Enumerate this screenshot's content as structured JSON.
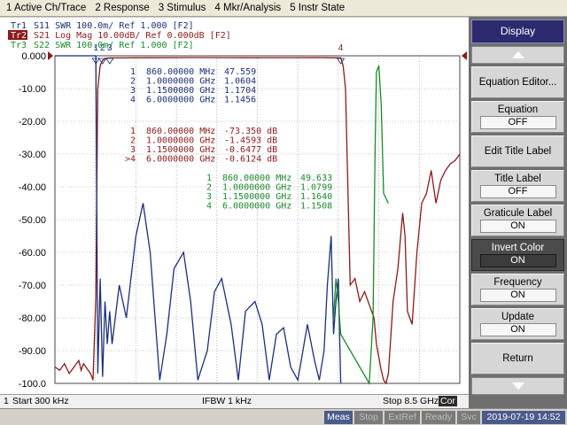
{
  "menu": [
    "1 Active Ch/Trace",
    "2 Response",
    "3 Stimulus",
    "4 Mkr/Analysis",
    "5 Instr State"
  ],
  "traces": [
    {
      "label": "Tr1",
      "text": "S11  SWR 100.0m/ Ref 1.000 [F2]",
      "color": "#1c2f78"
    },
    {
      "label": "Tr2",
      "text": "S21  Log Mag 10.00dB/ Ref 0.000dB [F2]",
      "color": "#8b1a1a"
    },
    {
      "label": "Tr3",
      "text": "S22  SWR 100.0m/ Ref 1.000 [F2]",
      "color": "#1a8a2a"
    }
  ],
  "y_tick_labels": [
    "0.000",
    "-10.00",
    "-20.00",
    "-30.00",
    "-40.00",
    "-50.00",
    "-60.00",
    "-70.00",
    "-80.00",
    "-90.00",
    "-100.0"
  ],
  "marker_tables": [
    {
      "color": "#1c2f78",
      "rows": [
        {
          "id": "1",
          "freq": "860.00000 MHz",
          "value": "47.559"
        },
        {
          "id": "2",
          "freq": "1.0000000 GHz",
          "value": "1.0604"
        },
        {
          "id": "3",
          "freq": "1.1500000 GHz",
          "value": "1.1704"
        },
        {
          "id": "4",
          "freq": "6.0000000 GHz",
          "value": "1.1456"
        }
      ]
    },
    {
      "color": "#8b1a1a",
      "rows": [
        {
          "id": "1",
          "freq": "860.00000 MHz",
          "value": "-73.350 dB"
        },
        {
          "id": "2",
          "freq": "1.0000000 GHz",
          "value": "-1.4593 dB"
        },
        {
          "id": "3",
          "freq": "1.1500000 GHz",
          "value": "-0.6477 dB"
        },
        {
          "id": ">4",
          "freq": "6.0000000 GHz",
          "value": "-0.6124 dB"
        }
      ]
    },
    {
      "color": "#1a8a2a",
      "rows": [
        {
          "id": "1",
          "freq": "860.00000 MHz",
          "value": "49.633"
        },
        {
          "id": "2",
          "freq": "1.0000000 GHz",
          "value": "1.0799"
        },
        {
          "id": "3",
          "freq": "1.1500000 GHz",
          "value": "1.1640"
        },
        {
          "id": "4",
          "freq": "6.0000000 GHz",
          "value": "1.1508"
        }
      ]
    }
  ],
  "marker_flags": [
    "1",
    "2",
    "3",
    "4"
  ],
  "status": {
    "channel": "1",
    "start": "Start 300 kHz",
    "ifbw": "IFBW 1 kHz",
    "stop": "Stop 8.5 GHz",
    "cor": "Cor"
  },
  "bottom": {
    "meas": "Meas",
    "stop": "Stop",
    "extref": "ExtRef",
    "ready": "Ready",
    "svc": "Svc",
    "datetime": "2019-07-19 14:52"
  },
  "softkeys": {
    "display": "Display",
    "equation_editor": "Equation Editor...",
    "equation": {
      "label": "Equation",
      "value": "OFF"
    },
    "edit_title_label": "Edit Title Label",
    "title_label": {
      "label": "Title Label",
      "value": "OFF"
    },
    "graticule_label": {
      "label": "Graticule Label",
      "value": "ON"
    },
    "invert_color": {
      "label": "Invert Color",
      "value": "ON"
    },
    "frequency": {
      "label": "Frequency",
      "value": "ON"
    },
    "update": {
      "label": "Update",
      "value": "ON"
    },
    "return": "Return"
  },
  "chart_data": {
    "type": "line",
    "x_range_hz": [
      300000,
      8500000000
    ],
    "ylim_db": [
      -100,
      0
    ],
    "grid": true,
    "series": [
      {
        "name": "S21 Log Mag",
        "color": "#8b1a1a",
        "x_ghz": [
          0.0003,
          0.1,
          0.2,
          0.3,
          0.4,
          0.5,
          0.55,
          0.6,
          0.65,
          0.7,
          0.75,
          0.8,
          0.86,
          0.88,
          0.9,
          0.95,
          1.0,
          1.05,
          1.15,
          2,
          3,
          4,
          5,
          5.5,
          5.7,
          5.9,
          6.0,
          6.05,
          6.1,
          6.2,
          6.3,
          6.4,
          6.5,
          6.6,
          6.7,
          6.75,
          6.8,
          6.85,
          6.9,
          6.95,
          7.0,
          7.1,
          7.2,
          7.3,
          7.35,
          7.4,
          7.5,
          7.6,
          7.7,
          7.8,
          7.9,
          8.0,
          8.1,
          8.2,
          8.3,
          8.4,
          8.5
        ],
        "values": [
          -95,
          -96,
          -94,
          -97,
          -95,
          -93,
          -96,
          -94,
          -95,
          -96,
          -97,
          -99,
          -73.35,
          -40,
          -10,
          -3,
          -1.46,
          -0.8,
          -0.65,
          -0.6,
          -0.55,
          -0.6,
          -0.58,
          -0.55,
          -0.6,
          -0.61,
          -0.61,
          -3,
          -10,
          -70,
          -68,
          -75,
          -72,
          -76,
          -80,
          -88,
          -92,
          -96,
          -99,
          -100,
          -97,
          -75,
          -65,
          -48,
          -55,
          -78,
          -82,
          -60,
          -45,
          -42,
          -35,
          -45,
          -38,
          -35,
          -33,
          -32,
          -30
        ]
      },
      {
        "name": "S11 SWR",
        "color": "#1c2f78",
        "x_ghz": [
          0.0003,
          0.5,
          0.8,
          0.86,
          0.9,
          0.95,
          1.0,
          1.05,
          1.1,
          1.15,
          1.2,
          1.35,
          1.5,
          1.7,
          1.85,
          2.0,
          2.2,
          2.35,
          2.5,
          2.7,
          2.85,
          3.0,
          3.2,
          3.35,
          3.5,
          3.7,
          3.85,
          4.0,
          4.2,
          4.35,
          4.5,
          4.65,
          4.8,
          4.95,
          5.1,
          5.3,
          5.45,
          5.55,
          5.65,
          5.72,
          5.8,
          5.85,
          5.9,
          5.95,
          6.0
        ],
        "values": [
          0,
          0,
          0,
          0,
          -97,
          -68,
          -98,
          -75,
          -88,
          -78,
          -88,
          -70,
          -80,
          -55,
          -45,
          -60,
          -99,
          -85,
          -65,
          -60,
          -75,
          -99,
          -90,
          -72,
          -68,
          -82,
          -99,
          -78,
          -75,
          -82,
          -99,
          -85,
          -83,
          -95,
          -99,
          -82,
          -93,
          -99,
          -90,
          -70,
          -55,
          -85,
          -75,
          -68,
          -100
        ]
      },
      {
        "name": "S22 SWR",
        "color": "#1a8a2a",
        "x_ghz": [
          5.85,
          5.9,
          5.95,
          6.0,
          6.6,
          6.68,
          6.72,
          6.75,
          6.8,
          6.85,
          6.9,
          7.0
        ],
        "values": [
          -80,
          -68,
          -75,
          -85,
          -100,
          -80,
          -30,
          -5,
          -3,
          -15,
          -42,
          -45
        ]
      }
    ]
  }
}
